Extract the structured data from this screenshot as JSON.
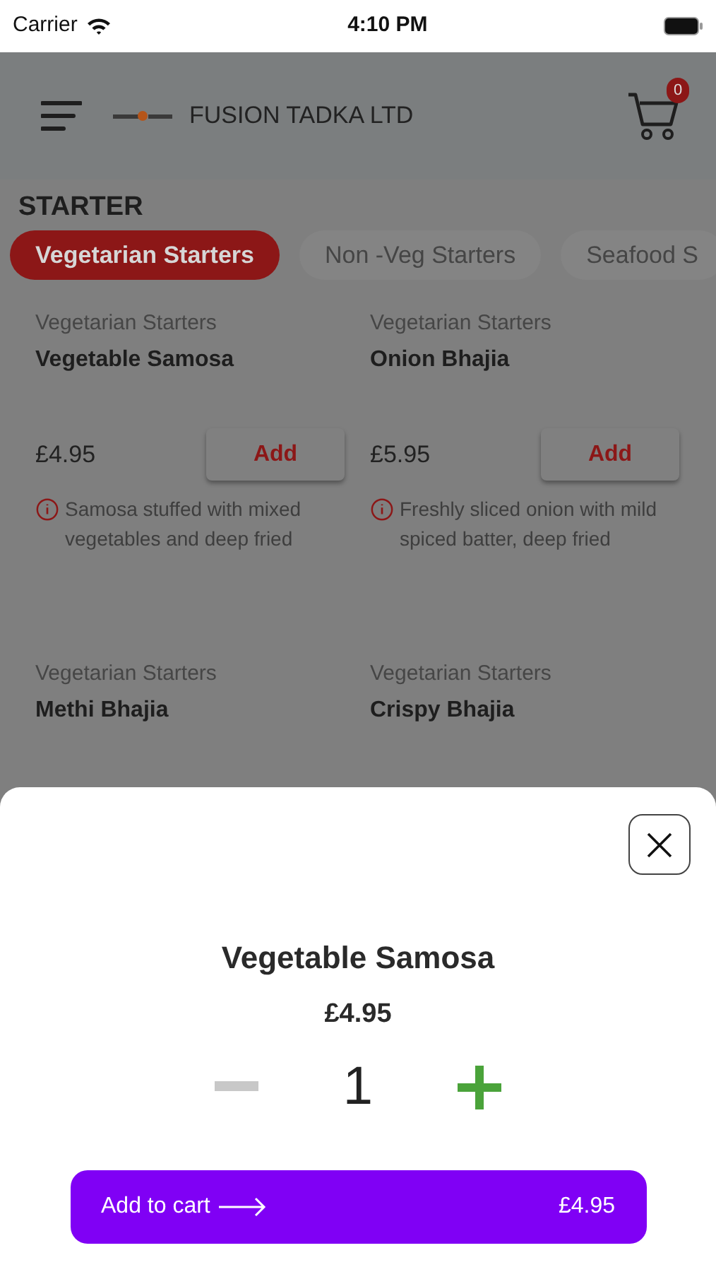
{
  "status_bar": {
    "carrier": "Carrier",
    "time": "4:10 PM"
  },
  "header": {
    "brand": "FUSION TADKA LTD",
    "cart_count": "0"
  },
  "section_title": "STARTER",
  "tabs": [
    {
      "label": "Vegetarian Starters",
      "selected": true
    },
    {
      "label": "Non -Veg Starters",
      "selected": false
    },
    {
      "label": "Seafood S",
      "selected": false
    }
  ],
  "items": [
    {
      "category": "Vegetarian Starters",
      "name": "Vegetable Samosa",
      "price": "£4.95",
      "button": "Add",
      "description": "Samosa stuffed with mixed vegetables and deep fried"
    },
    {
      "category": "Vegetarian Starters",
      "name": "Onion Bhajia",
      "price": "£5.95",
      "button": "Add",
      "description": "Freshly sliced onion with mild spiced batter, deep fried"
    },
    {
      "category": "Vegetarian Starters",
      "name": "Methi Bhajia"
    },
    {
      "category": "Vegetarian Starters",
      "name": "Crispy Bhajia"
    }
  ],
  "sheet": {
    "title": "Vegetable Samosa",
    "price": "£4.95",
    "quantity": "1",
    "add_button": {
      "label": "Add to cart",
      "total": "£4.95"
    }
  }
}
